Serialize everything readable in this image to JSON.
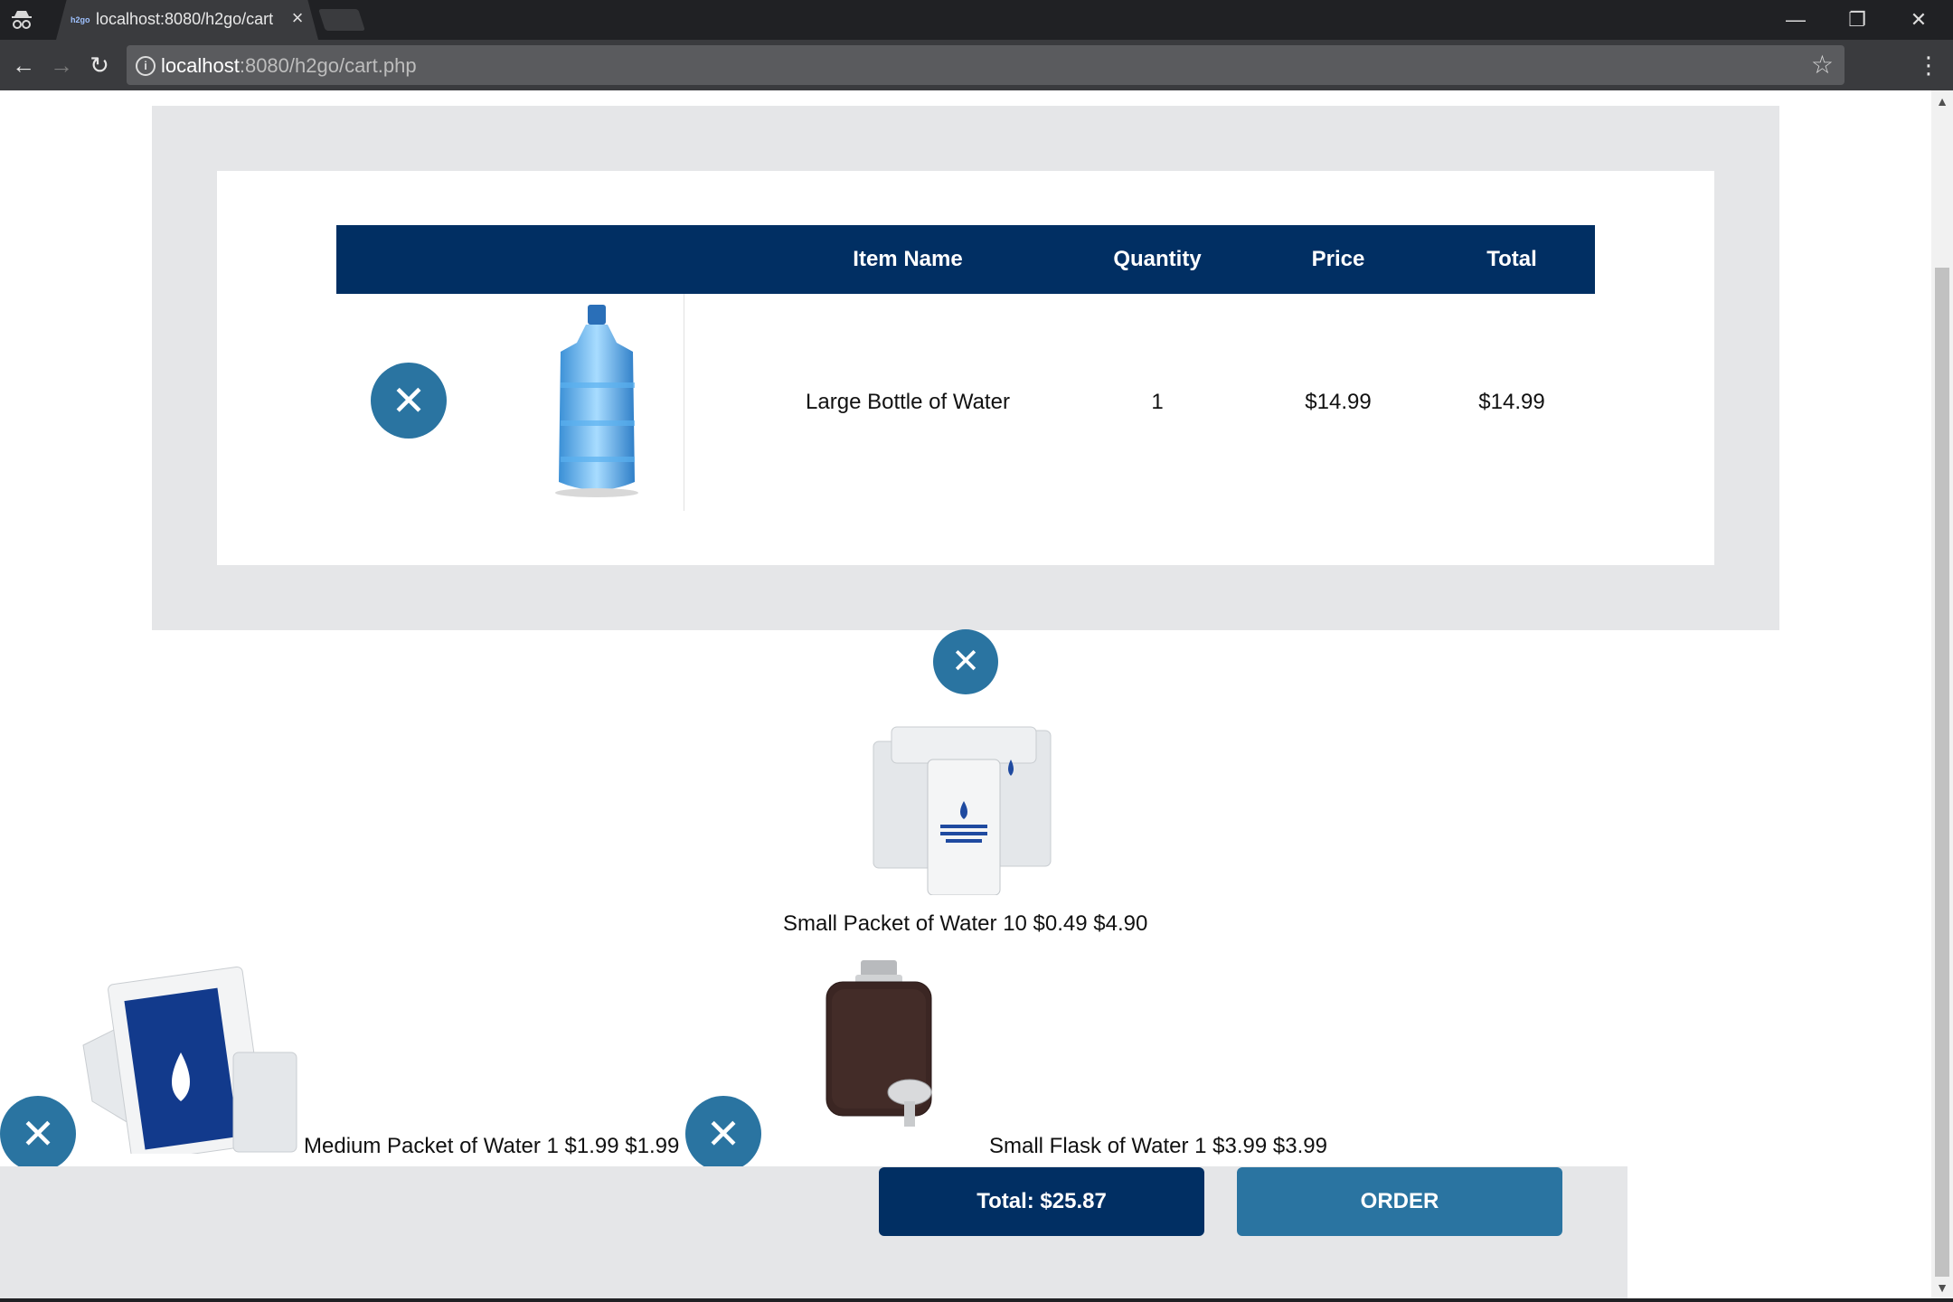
{
  "browser": {
    "tab_title": "localhost:8080/h2go/cart",
    "favicon_text": "h2go",
    "tab_close": "×",
    "url_host": "localhost",
    "url_rest": ":8080/h2go/cart.php",
    "icons": {
      "incognito": "incognito-icon",
      "back": "←",
      "forward": "→",
      "reload": "↻",
      "info": "i",
      "star": "☆",
      "menu": "⋮",
      "minimize": "—",
      "restore": "❐",
      "close": "✕"
    }
  },
  "cart": {
    "headers": [
      "Item Name",
      "Quantity",
      "Price",
      "Total"
    ],
    "items": [
      {
        "name": "Large Bottle of Water",
        "quantity": "1",
        "price": "$14.99",
        "total": "$14.99",
        "image": "water-jug-image"
      }
    ],
    "unstyled_items": [
      {
        "text": "Small Packet of Water 10 $0.49 $4.90",
        "image": "small-packet-image"
      },
      {
        "text": "Medium Packet of Water 1 $1.99 $1.99",
        "image": "medium-packet-image"
      },
      {
        "text": "Small Flask of Water 1 $3.99 $3.99",
        "image": "flask-image"
      }
    ],
    "remove_glyph": "✕"
  },
  "summary": {
    "total_label": "Total: $25.87",
    "order_label": "ORDER"
  },
  "colors": {
    "header_navy": "#012f63",
    "button_blue": "#2a74a1",
    "band_gray": "#e5e6e8"
  }
}
